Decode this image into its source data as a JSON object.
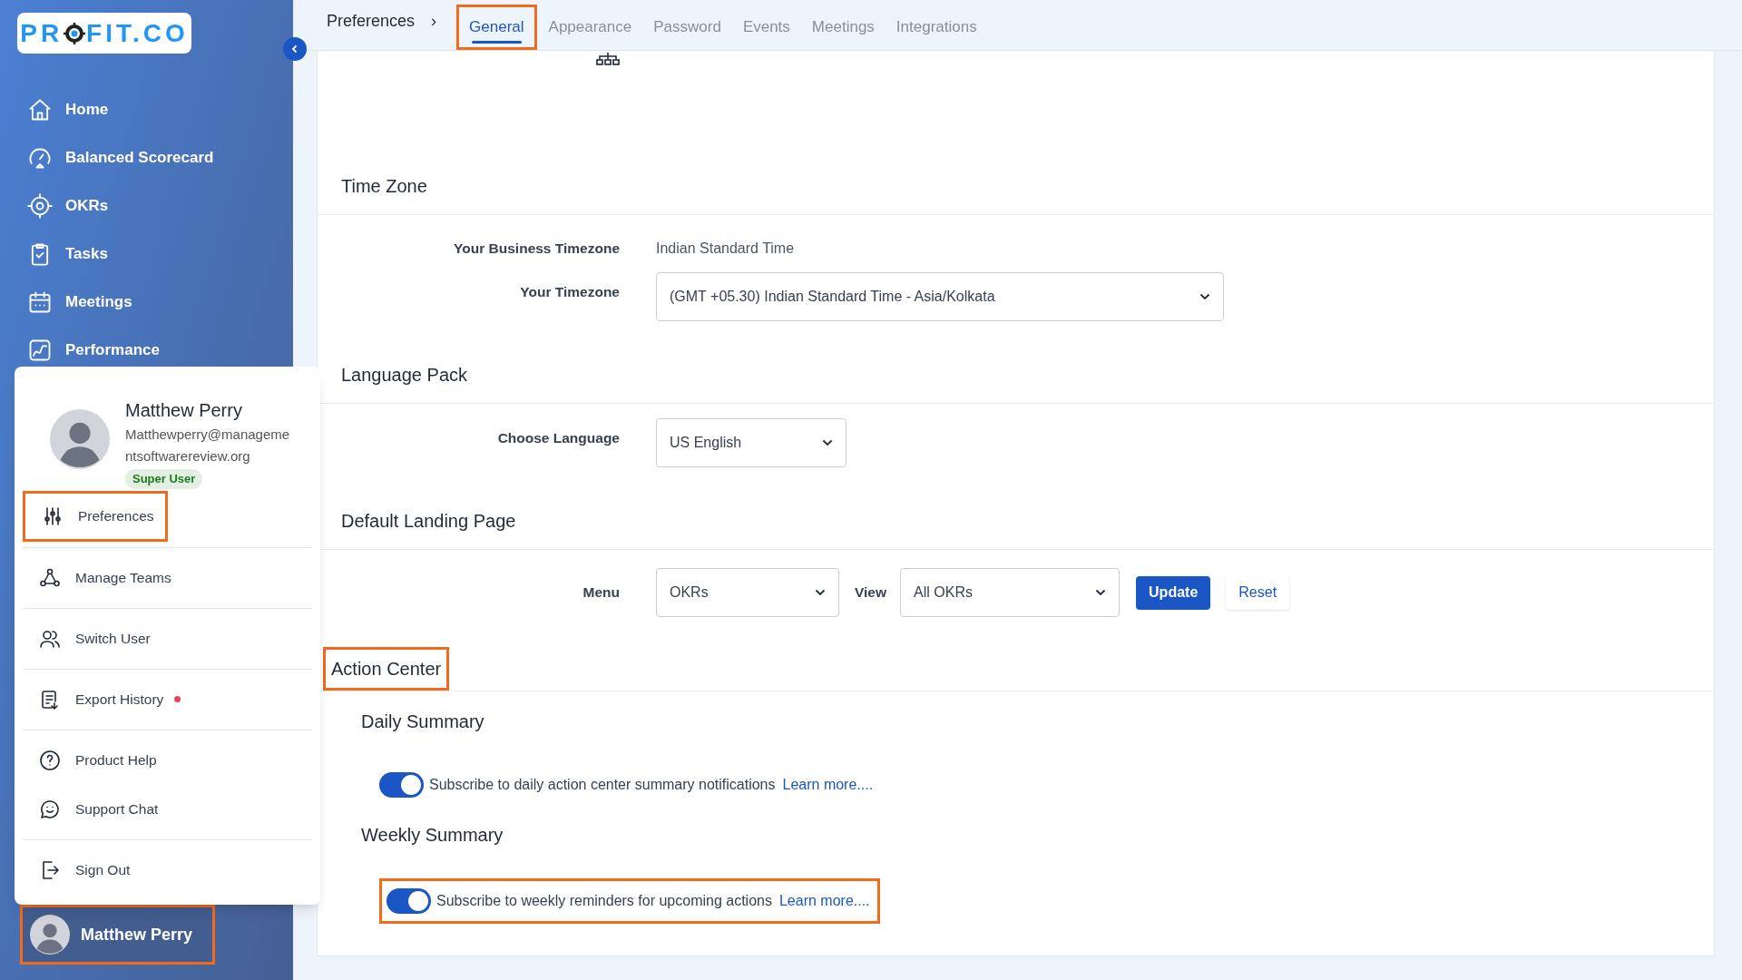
{
  "sidebar": {
    "logo": {
      "before": "PR",
      "after": "FIT.CO"
    },
    "items": [
      {
        "label": "Home",
        "kind": "home"
      },
      {
        "label": "Balanced Scorecard",
        "kind": "gauge"
      },
      {
        "label": "OKRs",
        "kind": "target"
      },
      {
        "label": "Tasks",
        "kind": "clipboard"
      },
      {
        "label": "Meetings",
        "kind": "calendar"
      },
      {
        "label": "Performance",
        "kind": "chart"
      }
    ],
    "user": {
      "name": "Matthew Perry",
      "highlighted": true
    }
  },
  "profile_menu": {
    "name": "Matthew Perry",
    "email_lines": [
      "Matthewperry@manageme",
      "ntsoftwarereview.org"
    ],
    "badge": "Super User",
    "groups": [
      [
        {
          "label": "Preferences",
          "kind": "sliders",
          "highlighted": true,
          "dot": false
        }
      ],
      [
        {
          "label": "Manage Teams",
          "kind": "team",
          "highlighted": false,
          "dot": false
        }
      ],
      [
        {
          "label": "Switch User",
          "kind": "users",
          "highlighted": false,
          "dot": false
        }
      ],
      [
        {
          "label": "Export History",
          "kind": "export",
          "highlighted": false,
          "dot": true
        }
      ],
      [
        {
          "label": "Product Help",
          "kind": "help",
          "highlighted": false,
          "dot": false
        },
        {
          "label": "Support Chat",
          "kind": "chat",
          "highlighted": false,
          "dot": false
        }
      ],
      [
        {
          "label": "Sign Out",
          "kind": "signout",
          "highlighted": false,
          "dot": false
        }
      ]
    ]
  },
  "breadcrumb": {
    "label": "Preferences",
    "separator": "›"
  },
  "tabs": [
    {
      "label": "General",
      "selected": true,
      "highlighted": true
    },
    {
      "label": "Appearance",
      "selected": false,
      "highlighted": false
    },
    {
      "label": "Password",
      "selected": false,
      "highlighted": false
    },
    {
      "label": "Events",
      "selected": false,
      "highlighted": false
    },
    {
      "label": "Meetings",
      "selected": false,
      "highlighted": false
    },
    {
      "label": "Integrations",
      "selected": false,
      "highlighted": false
    }
  ],
  "time_zone": {
    "title": "Time Zone",
    "business_label": "Your Business Timezone",
    "business_value": "Indian Standard Time",
    "timezone_label": "Your Timezone",
    "timezone_value": "(GMT +05.30) Indian Standard Time - Asia/Kolkata"
  },
  "language_pack": {
    "title": "Language Pack",
    "label": "Choose Language",
    "value": "US English"
  },
  "landing_page": {
    "title": "Default Landing Page",
    "menu_label": "Menu",
    "menu_value": "OKRs",
    "view_label": "View",
    "view_value": "All OKRs",
    "update": "Update",
    "reset": "Reset"
  },
  "action_center": {
    "title": "Action Center",
    "highlighted": true,
    "subsections": [
      {
        "title": "Daily Summary",
        "text": "Subscribe to daily action center summary notifications",
        "link": "Learn more....",
        "on": true,
        "highlighted": false
      },
      {
        "title": "Weekly Summary",
        "text": "Subscribe to weekly reminders for upcoming actions",
        "link": "Learn more....",
        "on": true,
        "highlighted": true
      }
    ]
  }
}
